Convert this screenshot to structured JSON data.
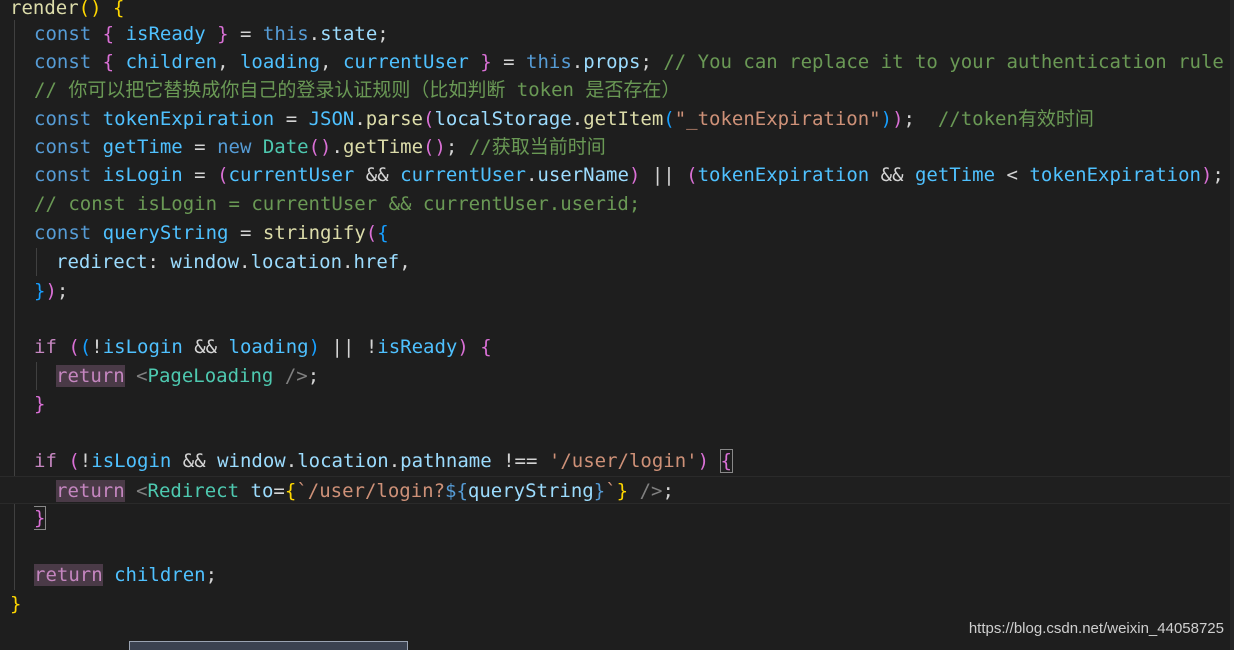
{
  "code": {
    "l1": {
      "a": "render",
      "b": "() ",
      "c": "{"
    },
    "l2": {
      "kw": "const",
      "b1": "{",
      "v1": "isReady",
      "b2": "}",
      "eq": " = ",
      "this": "this",
      "dot": ".",
      "p": "state",
      "semi": ";"
    },
    "l3": {
      "kw": "const",
      "b1": "{",
      "v1": "children",
      "v2": "loading",
      "v3": "currentUser",
      "b2": "}",
      "this": "this",
      "p": "props",
      "comment": "// You can replace it to your authentication rule"
    },
    "l4": {
      "comment": "// 你可以把它替换成你自己的登录认证规则（比如判断 token 是否存在）"
    },
    "l5": {
      "kw": "const",
      "v": "tokenExpiration",
      "json": "JSON",
      "parse": "parse",
      "ls": "localStorage",
      "getItem": "getItem",
      "str": "\"_tokenExpiration\"",
      "comment": "//token有效时间"
    },
    "l6": {
      "kw": "const",
      "v": "getTime",
      "new": "new",
      "date": "Date",
      "fn": "getTime",
      "comment": "//获取当前时间"
    },
    "l7": {
      "kw": "const",
      "v": "isLogin",
      "cu": "currentUser",
      "un": "userName",
      "te": "tokenExpiration",
      "gt": "getTime"
    },
    "l8": {
      "comment": "// const isLogin = currentUser && currentUser.userid;"
    },
    "l9": {
      "kw": "const",
      "v": "queryString",
      "fn": "stringify"
    },
    "l10": {
      "key": "redirect",
      "win": "window",
      "loc": "location",
      "href": "href"
    },
    "l12": {
      "kw": "if",
      "isLogin": "isLogin",
      "loading": "loading",
      "isReady": "isReady"
    },
    "l13": {
      "kw": "return",
      "tag": "PageLoading"
    },
    "l15": {
      "kw": "if",
      "isLogin": "isLogin",
      "win": "window",
      "loc": "location",
      "path": "pathname",
      "str": "'/user/login'"
    },
    "l16": {
      "kw": "return",
      "tag": "Redirect",
      "attr": "to",
      "tpl1": "`/user/login?",
      "tplv": "queryString",
      "tpl2": "`"
    },
    "l19": {
      "kw": "return",
      "v": "children"
    }
  },
  "watermark": "https://blog.csdn.net/weixin_44058725"
}
